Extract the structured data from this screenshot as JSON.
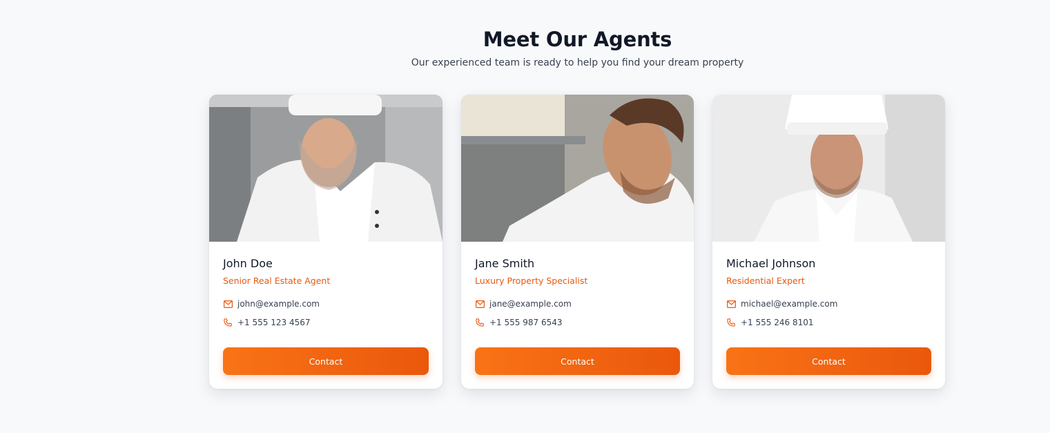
{
  "section": {
    "title": "Meet Our Agents",
    "subtitle": "Our experienced team is ready to help you find your dream property"
  },
  "agents": [
    {
      "name": "John Doe",
      "role": "Senior Real Estate Agent",
      "email": "john@example.com",
      "phone": "+1 555 123 4567",
      "button": "Contact",
      "photo": "chef-portrait-smiling-kitchen"
    },
    {
      "name": "Jane Smith",
      "role": "Luxury Property Specialist",
      "email": "jane@example.com",
      "phone": "+1 555 987 6543",
      "button": "Contact",
      "photo": "chef-leaning-over-counter"
    },
    {
      "name": "Michael Johnson",
      "role": "Residential Expert",
      "email": "michael@example.com",
      "phone": "+1 555 246 8101",
      "button": "Contact",
      "photo": "chef-portrait-white-background"
    }
  ],
  "icons": {
    "email": "mail-icon",
    "phone": "phone-icon"
  },
  "colors": {
    "accent": "#ea580c",
    "accent_light": "#f97316",
    "background": "#f8f9fb",
    "heading": "#111827"
  }
}
